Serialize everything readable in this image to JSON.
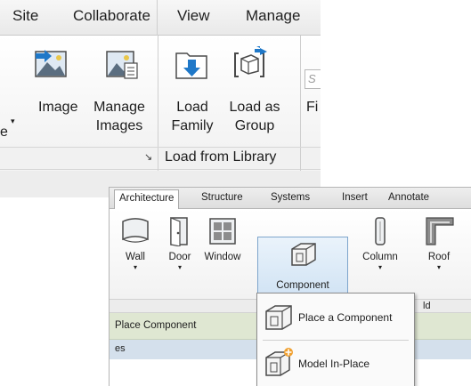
{
  "top_ribbon": {
    "tabs": [
      "Site",
      "Collaborate",
      "View",
      "Manage"
    ],
    "buttons": {
      "image": "Image",
      "manage_images_1": "Manage",
      "manage_images_2": "Images",
      "load_family_1": "Load",
      "load_family_2": "Family",
      "load_group_1": "Load as",
      "load_group_2": "Group"
    },
    "cut_left_text": "e",
    "cut_right_text_1": "S",
    "cut_right_text_2": "Fi",
    "panel_launcher": "↘",
    "panel_label": "Load from Library"
  },
  "inset_ribbon": {
    "tabs": [
      "Architecture",
      "Structure",
      "Systems",
      "Insert",
      "Annotate"
    ],
    "tools": {
      "wall": "Wall",
      "door": "Door",
      "window": "Window",
      "component": "Component",
      "column": "Column",
      "roof": "Roof"
    },
    "panel_fragment": "ld",
    "context_label": "Place Component",
    "context_fragment": "es",
    "dropdown": {
      "place_component": "Place a Component",
      "model_in_place": "Model In-Place"
    }
  },
  "colors": {
    "blue_arrow": "#1f78c8",
    "highlight": "#c9def2",
    "context_green": "#dfe7d2",
    "orange_badge": "#f0a030"
  }
}
